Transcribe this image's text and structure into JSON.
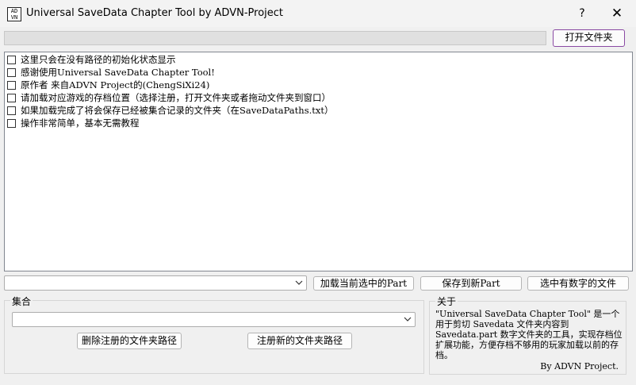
{
  "window": {
    "title": "Universal SaveData Chapter Tool by ADVN-Project",
    "icon_text": "AD VN",
    "help": "?",
    "close": "✕"
  },
  "path_bar": {
    "value": "",
    "open_folder_label": "打开文件夹"
  },
  "list": {
    "items": [
      {
        "label": "这里只会在没有路径的初始化状态显示",
        "checked": false
      },
      {
        "label": "感谢使用Universal SaveData Chapter Tool!",
        "checked": false
      },
      {
        "label": "原作者 来自ADVN Project的(ChengSiXi24)",
        "checked": false
      },
      {
        "label": "请加载对应游戏的存档位置（选择注册，打开文件夹或者拖动文件夹到窗口）",
        "checked": false
      },
      {
        "label": "如果加载完成了将会保存已经被集合记录的文件夹（在SaveDataPaths.txt）",
        "checked": false
      },
      {
        "label": "操作非常简单，基本无需教程",
        "checked": false
      }
    ]
  },
  "actions": {
    "part_select_value": "",
    "load_part_label": "加载当前选中的Part",
    "save_part_label": "保存到新Part",
    "select_numbered_label": "选中有数字的文件"
  },
  "collection": {
    "legend": "集合",
    "select_value": "",
    "delete_label": "删除注册的文件夹路径",
    "register_label": "注册新的文件夹路径"
  },
  "about": {
    "legend": "关于",
    "text": "\"Universal SaveData Chapter Tool\" 是一个用于剪切 Savedata 文件夹内容到 Savedata.part 数字文件夹的工具，实现存档位扩展功能，方便存档不够用的玩家加载以前的存档。",
    "signature": "By ADVN Project."
  },
  "colors": {
    "window_bg": "#f0f0f0",
    "accent_border": "#8a4aa3"
  }
}
